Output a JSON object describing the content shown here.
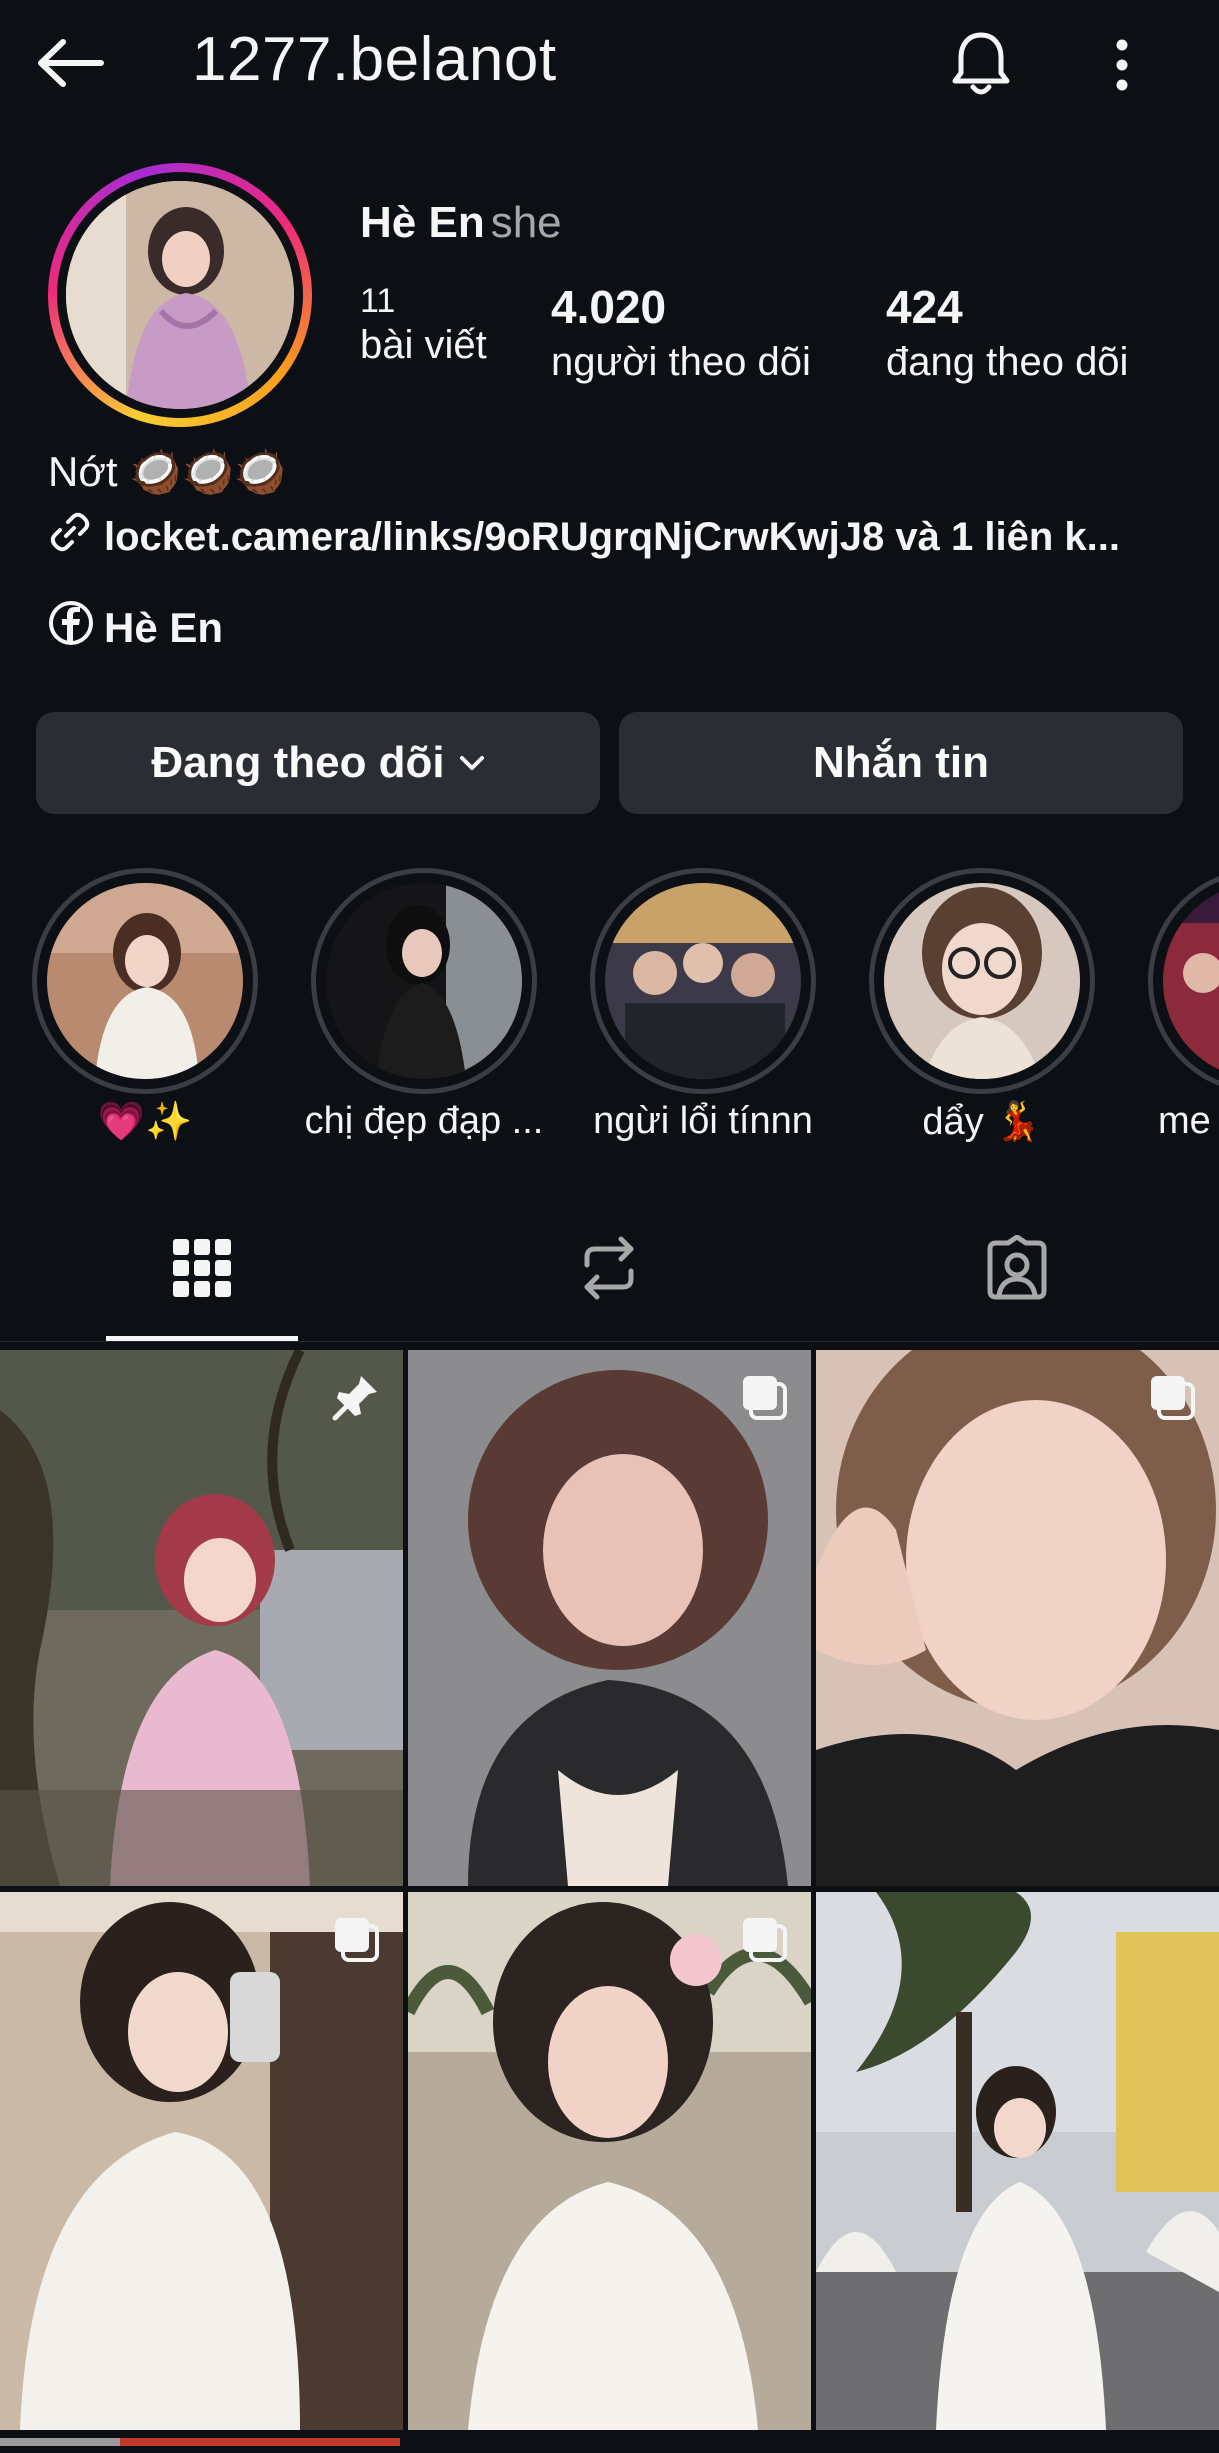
{
  "header": {
    "username": "1277.belanot",
    "back_icon": "arrow-left-icon",
    "bell_icon": "bell-icon",
    "more_icon": "more-vertical-icon"
  },
  "profile": {
    "display_name": "Hè En",
    "pronoun": "she",
    "stats": {
      "posts": {
        "value": "11",
        "label": "bài viết"
      },
      "followers": {
        "value": "4.020",
        "label": "người theo dõi"
      },
      "following": {
        "value": "424",
        "label": "đang theo dõi"
      }
    },
    "bio": "Nớt 🥥🥥🥥",
    "link": "locket.camera/links/9oRUgrqNjCrwKwjJ8 và 1 liên k...",
    "facebook_name": "Hè En"
  },
  "actions": {
    "following_label": "Đang theo dõi",
    "message_label": "Nhắn tin"
  },
  "highlights": [
    {
      "label": "💗✨"
    },
    {
      "label": "chị đẹp đạp ..."
    },
    {
      "label": "ngừi lổi tínnn"
    },
    {
      "label": "dẩy 💃"
    },
    {
      "label": "me"
    }
  ],
  "tabs": [
    "grid-icon",
    "reposts-icon",
    "tagged-icon"
  ],
  "colors": {
    "background": "#0c0f14",
    "button": "#2a2d33",
    "secondary_text": "#a8a8a8"
  }
}
